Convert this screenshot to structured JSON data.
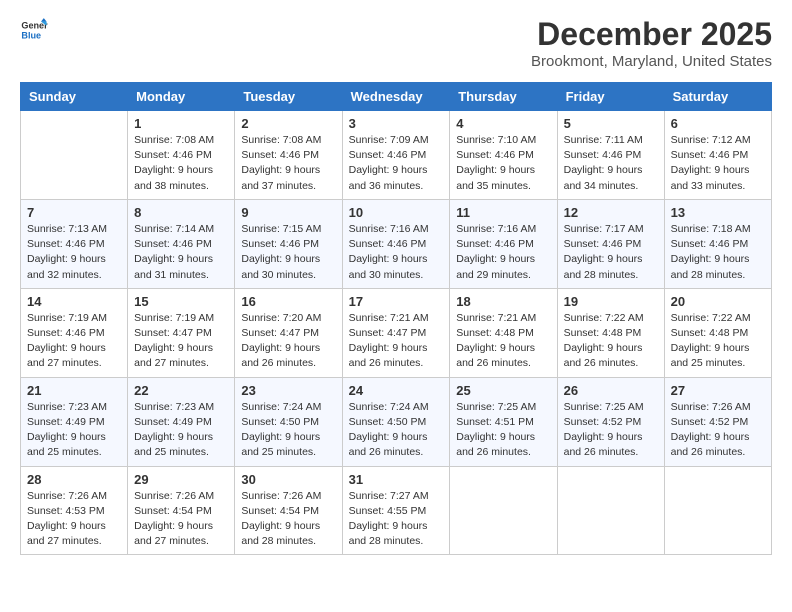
{
  "logo": {
    "line1": "General",
    "line2": "Blue"
  },
  "title": "December 2025",
  "location": "Brookmont, Maryland, United States",
  "days_of_week": [
    "Sunday",
    "Monday",
    "Tuesday",
    "Wednesday",
    "Thursday",
    "Friday",
    "Saturday"
  ],
  "weeks": [
    [
      {
        "day": "",
        "sunrise": "",
        "sunset": "",
        "daylight": ""
      },
      {
        "day": "1",
        "sunrise": "Sunrise: 7:08 AM",
        "sunset": "Sunset: 4:46 PM",
        "daylight": "Daylight: 9 hours and 38 minutes."
      },
      {
        "day": "2",
        "sunrise": "Sunrise: 7:08 AM",
        "sunset": "Sunset: 4:46 PM",
        "daylight": "Daylight: 9 hours and 37 minutes."
      },
      {
        "day": "3",
        "sunrise": "Sunrise: 7:09 AM",
        "sunset": "Sunset: 4:46 PM",
        "daylight": "Daylight: 9 hours and 36 minutes."
      },
      {
        "day": "4",
        "sunrise": "Sunrise: 7:10 AM",
        "sunset": "Sunset: 4:46 PM",
        "daylight": "Daylight: 9 hours and 35 minutes."
      },
      {
        "day": "5",
        "sunrise": "Sunrise: 7:11 AM",
        "sunset": "Sunset: 4:46 PM",
        "daylight": "Daylight: 9 hours and 34 minutes."
      },
      {
        "day": "6",
        "sunrise": "Sunrise: 7:12 AM",
        "sunset": "Sunset: 4:46 PM",
        "daylight": "Daylight: 9 hours and 33 minutes."
      }
    ],
    [
      {
        "day": "7",
        "sunrise": "Sunrise: 7:13 AM",
        "sunset": "Sunset: 4:46 PM",
        "daylight": "Daylight: 9 hours and 32 minutes."
      },
      {
        "day": "8",
        "sunrise": "Sunrise: 7:14 AM",
        "sunset": "Sunset: 4:46 PM",
        "daylight": "Daylight: 9 hours and 31 minutes."
      },
      {
        "day": "9",
        "sunrise": "Sunrise: 7:15 AM",
        "sunset": "Sunset: 4:46 PM",
        "daylight": "Daylight: 9 hours and 30 minutes."
      },
      {
        "day": "10",
        "sunrise": "Sunrise: 7:16 AM",
        "sunset": "Sunset: 4:46 PM",
        "daylight": "Daylight: 9 hours and 30 minutes."
      },
      {
        "day": "11",
        "sunrise": "Sunrise: 7:16 AM",
        "sunset": "Sunset: 4:46 PM",
        "daylight": "Daylight: 9 hours and 29 minutes."
      },
      {
        "day": "12",
        "sunrise": "Sunrise: 7:17 AM",
        "sunset": "Sunset: 4:46 PM",
        "daylight": "Daylight: 9 hours and 28 minutes."
      },
      {
        "day": "13",
        "sunrise": "Sunrise: 7:18 AM",
        "sunset": "Sunset: 4:46 PM",
        "daylight": "Daylight: 9 hours and 28 minutes."
      }
    ],
    [
      {
        "day": "14",
        "sunrise": "Sunrise: 7:19 AM",
        "sunset": "Sunset: 4:46 PM",
        "daylight": "Daylight: 9 hours and 27 minutes."
      },
      {
        "day": "15",
        "sunrise": "Sunrise: 7:19 AM",
        "sunset": "Sunset: 4:47 PM",
        "daylight": "Daylight: 9 hours and 27 minutes."
      },
      {
        "day": "16",
        "sunrise": "Sunrise: 7:20 AM",
        "sunset": "Sunset: 4:47 PM",
        "daylight": "Daylight: 9 hours and 26 minutes."
      },
      {
        "day": "17",
        "sunrise": "Sunrise: 7:21 AM",
        "sunset": "Sunset: 4:47 PM",
        "daylight": "Daylight: 9 hours and 26 minutes."
      },
      {
        "day": "18",
        "sunrise": "Sunrise: 7:21 AM",
        "sunset": "Sunset: 4:48 PM",
        "daylight": "Daylight: 9 hours and 26 minutes."
      },
      {
        "day": "19",
        "sunrise": "Sunrise: 7:22 AM",
        "sunset": "Sunset: 4:48 PM",
        "daylight": "Daylight: 9 hours and 26 minutes."
      },
      {
        "day": "20",
        "sunrise": "Sunrise: 7:22 AM",
        "sunset": "Sunset: 4:48 PM",
        "daylight": "Daylight: 9 hours and 25 minutes."
      }
    ],
    [
      {
        "day": "21",
        "sunrise": "Sunrise: 7:23 AM",
        "sunset": "Sunset: 4:49 PM",
        "daylight": "Daylight: 9 hours and 25 minutes."
      },
      {
        "day": "22",
        "sunrise": "Sunrise: 7:23 AM",
        "sunset": "Sunset: 4:49 PM",
        "daylight": "Daylight: 9 hours and 25 minutes."
      },
      {
        "day": "23",
        "sunrise": "Sunrise: 7:24 AM",
        "sunset": "Sunset: 4:50 PM",
        "daylight": "Daylight: 9 hours and 25 minutes."
      },
      {
        "day": "24",
        "sunrise": "Sunrise: 7:24 AM",
        "sunset": "Sunset: 4:50 PM",
        "daylight": "Daylight: 9 hours and 26 minutes."
      },
      {
        "day": "25",
        "sunrise": "Sunrise: 7:25 AM",
        "sunset": "Sunset: 4:51 PM",
        "daylight": "Daylight: 9 hours and 26 minutes."
      },
      {
        "day": "26",
        "sunrise": "Sunrise: 7:25 AM",
        "sunset": "Sunset: 4:52 PM",
        "daylight": "Daylight: 9 hours and 26 minutes."
      },
      {
        "day": "27",
        "sunrise": "Sunrise: 7:26 AM",
        "sunset": "Sunset: 4:52 PM",
        "daylight": "Daylight: 9 hours and 26 minutes."
      }
    ],
    [
      {
        "day": "28",
        "sunrise": "Sunrise: 7:26 AM",
        "sunset": "Sunset: 4:53 PM",
        "daylight": "Daylight: 9 hours and 27 minutes."
      },
      {
        "day": "29",
        "sunrise": "Sunrise: 7:26 AM",
        "sunset": "Sunset: 4:54 PM",
        "daylight": "Daylight: 9 hours and 27 minutes."
      },
      {
        "day": "30",
        "sunrise": "Sunrise: 7:26 AM",
        "sunset": "Sunset: 4:54 PM",
        "daylight": "Daylight: 9 hours and 28 minutes."
      },
      {
        "day": "31",
        "sunrise": "Sunrise: 7:27 AM",
        "sunset": "Sunset: 4:55 PM",
        "daylight": "Daylight: 9 hours and 28 minutes."
      },
      {
        "day": "",
        "sunrise": "",
        "sunset": "",
        "daylight": ""
      },
      {
        "day": "",
        "sunrise": "",
        "sunset": "",
        "daylight": ""
      },
      {
        "day": "",
        "sunrise": "",
        "sunset": "",
        "daylight": ""
      }
    ]
  ]
}
